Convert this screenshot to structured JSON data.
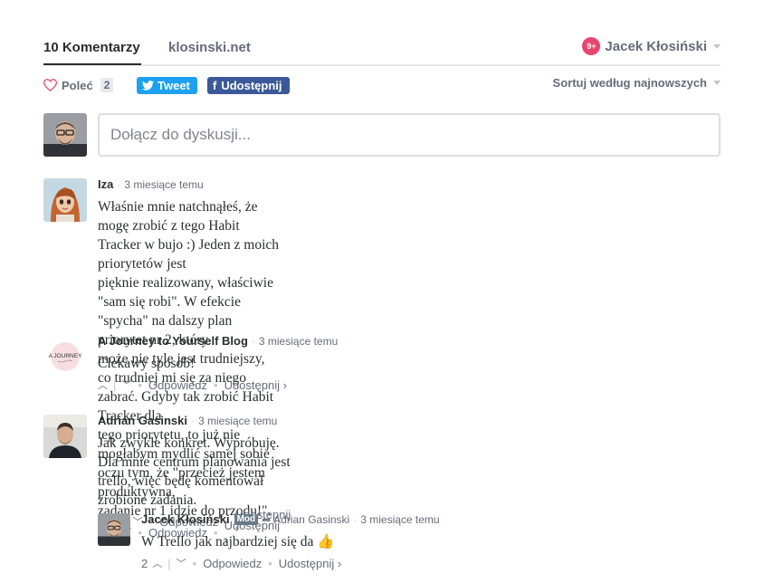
{
  "nav": {
    "comments_tab": "10 Komentarzy",
    "site_tab": "klosinski.net",
    "notif_badge": "9+",
    "user_name": "Jacek Kłosiński"
  },
  "actions": {
    "recommend_label": "Poleć",
    "recommend_count": "2",
    "tweet_label": "Tweet",
    "share_label": "Udostępnij",
    "sort_label": "Sortuj według najnowszych"
  },
  "composer": {
    "placeholder": "Dołącz do dyskusji..."
  },
  "colors": {
    "accent": "#2e9fff",
    "notif": "#e8466c",
    "twitter": "#1da1f2",
    "facebook": "#3b5998"
  },
  "comments": [
    {
      "author": "Iza",
      "time": "3 miesiące temu",
      "text_lines": [
        "Właśnie mnie natchnąłeś, że mogę zrobić z tego Habit Tracker w bujo :) Jeden z moich priorytetów jest",
        "pięknie realizowany, właściwie \"sam się robi\". W efekcie \"spycha\" na dalszy plan priorytet nr 2, który",
        "może nie tyle jest trudniejszy, co trudniej mi się za niego zabrać. Gdyby tak zrobić Habit Tracker dla",
        "tego priorytetu, to już nie mogłabym mydlić samej sobie oczu tym, że \"przecież jestem produktywna,",
        "zadanie nr 1 idzie do przodu!\"."
      ],
      "reply": "Odpowiedz",
      "share": "Udostępnij ›"
    },
    {
      "author": "A Journey to Yourself Blog",
      "avatar_text": "A JOURNEY",
      "time": "3 miesiące temu",
      "text_lines": [
        "Ciekawy sposob!"
      ],
      "reply": "Odpowiedz",
      "share": "Udostępnij ›"
    },
    {
      "author": "Adrian Gasinski",
      "time": "3 miesiące temu",
      "text_lines": [
        "Jak zwykle konkret. Wypróbuję. Dla mnie centrum planowania jest trello, więc będę komentował",
        "zrobione zadania."
      ],
      "votes": "1",
      "reply": "Odpowiedz",
      "share": "Udostępnij ›"
    },
    {
      "author": "Jacek Kłosiński",
      "badge": "Mod",
      "parent": "Adrian Gasinski",
      "time": "3 miesiące temu",
      "text_lines": [
        "W Trello jak najbardziej się da 👍"
      ],
      "votes": "2",
      "reply": "Odpowiedz",
      "share": "Udostępnij ›"
    }
  ]
}
